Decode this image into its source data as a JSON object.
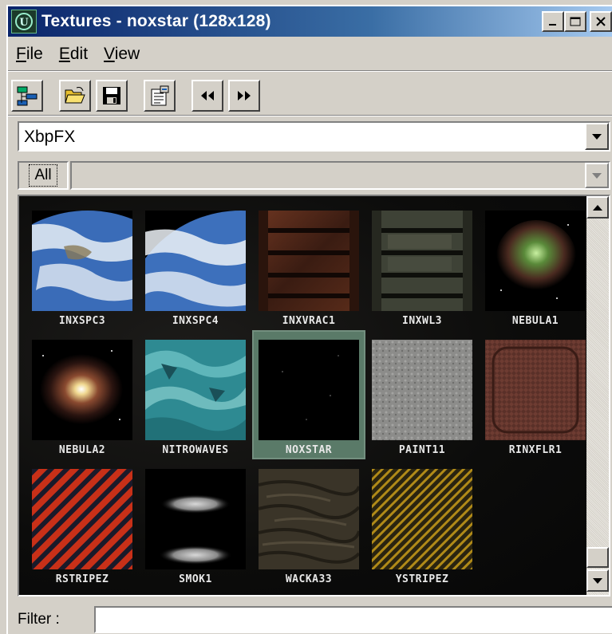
{
  "window": {
    "title": "Textures - noxstar (128x128)",
    "minimize": "_",
    "maximize": "□",
    "close": "×"
  },
  "menu": [
    {
      "label": "File",
      "accel": "F",
      "rest": "ile"
    },
    {
      "label": "Edit",
      "accel": "E",
      "rest": "dit"
    },
    {
      "label": "View",
      "accel": "V",
      "rest": "iew"
    }
  ],
  "toolbar": {
    "icons": [
      "collapse-tree-icon",
      "open-folder-icon",
      "save-icon",
      "properties-icon",
      "previous-icon",
      "next-icon"
    ]
  },
  "package_combo": {
    "value": "XbpFX"
  },
  "group": {
    "tab_label": "All",
    "value": ""
  },
  "textures": [
    {
      "name": "INXSPC3"
    },
    {
      "name": "INXSPC4"
    },
    {
      "name": "INXVRAC1"
    },
    {
      "name": "INXWL3"
    },
    {
      "name": "NEBULA1"
    },
    {
      "name": "NEBULA2"
    },
    {
      "name": "NITROWAVES"
    },
    {
      "name": "NOXSTAR",
      "selected": true
    },
    {
      "name": "PAINT11"
    },
    {
      "name": "RINXFLR1"
    },
    {
      "name": "RSTRIPEZ"
    },
    {
      "name": "SMOK1"
    },
    {
      "name": "WACKA33"
    },
    {
      "name": "YSTRIPEZ"
    }
  ],
  "filter": {
    "label": "Filter :",
    "value": ""
  },
  "colors": {
    "titlebar_start": "#0a246a",
    "titlebar_end": "#a6caf0",
    "face": "#d4d0c8",
    "selection": "#5a7a68"
  }
}
